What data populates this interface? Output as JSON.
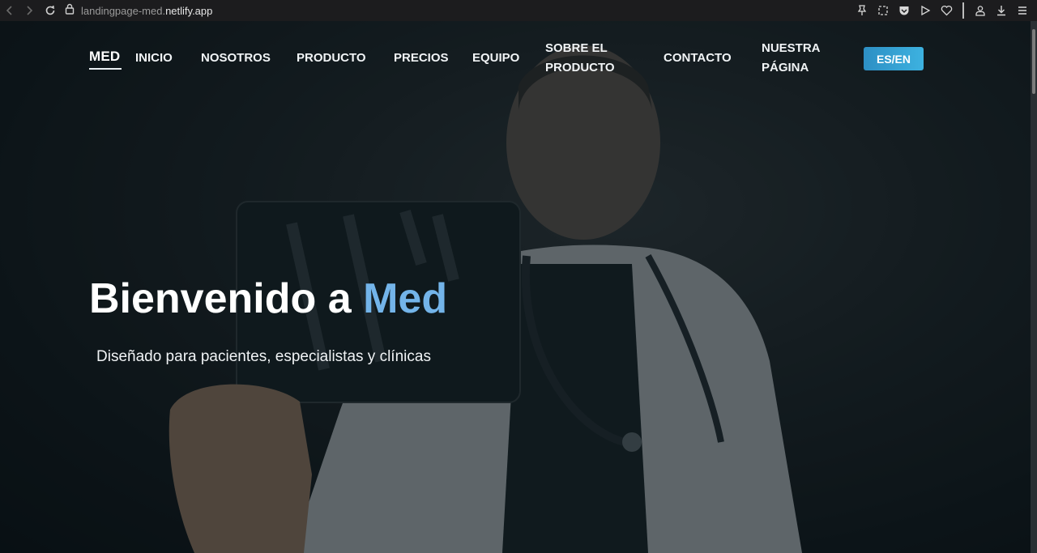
{
  "browser": {
    "url_prefix": "landingpage-med.",
    "url_domain": "netlify.app",
    "icons": [
      "back-icon",
      "forward-icon",
      "reload-icon",
      "lock-icon",
      "pin-icon",
      "screenshot-icon",
      "pocket-icon",
      "play-icon",
      "heart-icon",
      "profile-icon",
      "download-icon",
      "menu-icon"
    ]
  },
  "nav": {
    "logo": "MED",
    "links": [
      "INICIO",
      "NOSOTROS",
      "PRODUCTO",
      "PRECIOS",
      "EQUIPO"
    ],
    "sobre_line1": "SOBRE EL",
    "sobre_line2": "PRODUCTO",
    "contacto": "CONTACTO",
    "nuestra_line1": "NUESTRA",
    "nuestra_line2": "PÁGINA",
    "lang": "ES/EN"
  },
  "hero": {
    "title_prefix": "Bienvenido a ",
    "title_accent": "Med",
    "subtitle": "Diseñado para pacientes, especialistas y clínicas"
  },
  "colors": {
    "accent": "#73b4e9",
    "lang_button": "#3db2e0"
  }
}
